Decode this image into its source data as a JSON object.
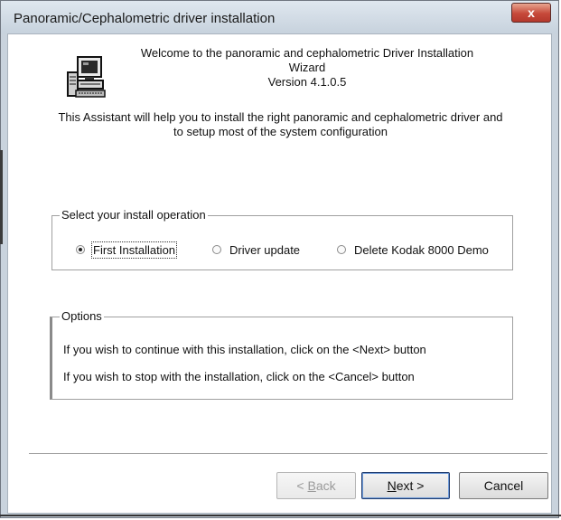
{
  "window": {
    "title": "Panoramic/Cephalometric driver installation",
    "close_glyph": "x"
  },
  "welcome": {
    "line1": "Welcome to the panoramic and cephalometric Driver Installation",
    "line2": "Wizard",
    "version": "Version 4.1.0.5"
  },
  "assistant": {
    "line1": "This Assistant will help you to install the right panoramic and cephalometric driver and",
    "line2": "to setup most of the system configuration"
  },
  "install_operation": {
    "label": "Select your install operation",
    "options": [
      {
        "label": "First Installation",
        "selected": true
      },
      {
        "label": "Driver update",
        "selected": false
      },
      {
        "label": "Delete Kodak 8000 Demo",
        "selected": false
      }
    ]
  },
  "options": {
    "label": "Options",
    "line1": "If you wish to continue with this installation, click on the <Next> button",
    "line2": "If you wish to stop with the installation, click on the <Cancel> button"
  },
  "buttons": {
    "back": {
      "prefix": "< ",
      "accel": "B",
      "rest": "ack",
      "enabled": false
    },
    "next": {
      "accel": "N",
      "rest": "ext >",
      "enabled": true
    },
    "cancel": {
      "label": "Cancel",
      "enabled": true
    }
  },
  "icons": {
    "app_icon": "computer-setup-icon",
    "close_icon": "close-icon"
  }
}
